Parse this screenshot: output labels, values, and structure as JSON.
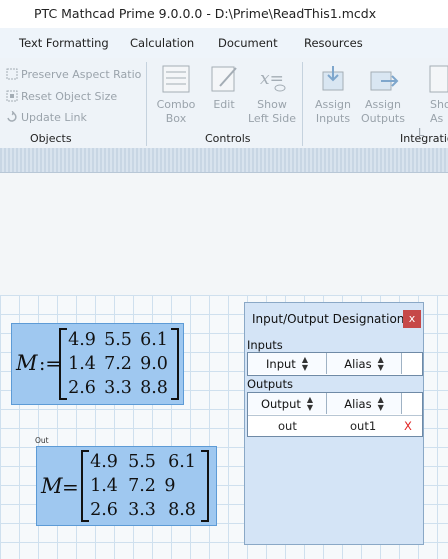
{
  "window": {
    "title": "PTC Mathcad Prime 9.0.0.0 - D:\\Prime\\ReadThis1.mcdx"
  },
  "tabs": [
    {
      "label": "Text Formatting"
    },
    {
      "label": "Calculation"
    },
    {
      "label": "Document"
    },
    {
      "label": "Resources"
    }
  ],
  "ribbon": {
    "objects": {
      "label": "Objects",
      "items": [
        "Preserve Aspect Ratio",
        "Reset Object Size",
        "Update Link"
      ]
    },
    "controls": {
      "label": "Controls",
      "items": [
        {
          "line1": "Combo",
          "line2": "Box"
        },
        {
          "line1": "Edit",
          "line2": ""
        },
        {
          "line1": "Show",
          "line2": "Left Side"
        }
      ]
    },
    "integration": {
      "label": "Integration",
      "items": [
        {
          "line1": "Assign",
          "line2": "Inputs"
        },
        {
          "line1": "Assign",
          "line2": "Outputs"
        },
        {
          "line1": "Sho",
          "line2": "As L"
        }
      ]
    }
  },
  "worksheet": {
    "region1": {
      "lhs": "M",
      "op": ":=",
      "rows": [
        [
          "4.9",
          "5.5",
          "6.1"
        ],
        [
          "1.4",
          "7.2",
          "9.0"
        ],
        [
          "2.6",
          "3.3",
          "8.8"
        ]
      ]
    },
    "region2": {
      "tag": "Out",
      "lhs": "M",
      "op": "=",
      "rows": [
        [
          "4.9",
          "5.5",
          "6.1"
        ],
        [
          "1.4",
          "7.2",
          "9"
        ],
        [
          "2.6",
          "3.3",
          "8.8"
        ]
      ]
    }
  },
  "dialog": {
    "title": "Input/Output Designation",
    "close": "x",
    "inputs_label": "Inputs",
    "inputs_headers": [
      "Input",
      "Alias"
    ],
    "outputs_label": "Outputs",
    "outputs_headers": [
      "Output",
      "Alias"
    ],
    "outputs_rows": [
      {
        "name": "out",
        "alias": "out1",
        "delete": "X"
      }
    ]
  },
  "colors": {
    "region_fill": "#9fc8f0",
    "delete_x": "#e12424",
    "close_button": "#c64848"
  }
}
